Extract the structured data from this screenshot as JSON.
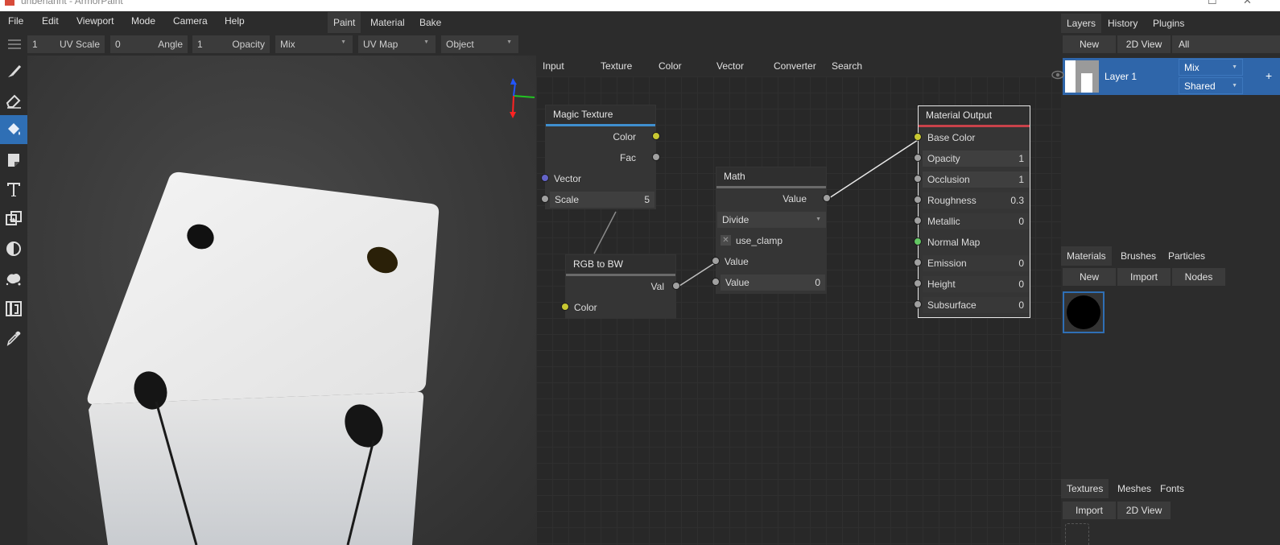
{
  "window": {
    "title": "unbehannt - ArmorPaint"
  },
  "menu": [
    "File",
    "Edit",
    "Viewport",
    "Mode",
    "Camera",
    "Help"
  ],
  "mode_tabs": [
    "Paint",
    "Material",
    "Bake"
  ],
  "toolbar": {
    "uv_scale": {
      "value": "1",
      "label": "UV Scale"
    },
    "angle": {
      "value": "0",
      "label": "Angle"
    },
    "opacity": {
      "value": "1",
      "label": "Opacity"
    },
    "blend": "Mix",
    "uv_map": "UV Map",
    "object": "Object"
  },
  "tools": [
    "brush-icon",
    "eraser-icon",
    "fill-icon",
    "decal-icon",
    "text-icon",
    "clone-icon",
    "blur-icon",
    "particle-icon",
    "bake-icon",
    "picker-icon"
  ],
  "node_categories": [
    "Input",
    "Texture",
    "Color",
    "Vector",
    "Converter",
    "Search"
  ],
  "nodes": {
    "magic_texture": {
      "title": "Magic Texture",
      "out_color": "Color",
      "out_fac": "Fac",
      "in_vector": "Vector",
      "scale_label": "Scale",
      "scale_value": "5"
    },
    "rgb_to_bw": {
      "title": "RGB to BW",
      "out_val": "Val",
      "in_color": "Color"
    },
    "math": {
      "title": "Math",
      "out_value": "Value",
      "operation": "Divide",
      "clamp_label": "use_clamp",
      "in_value1": "Value",
      "in_value2": "Value",
      "in_value2_num": "0"
    },
    "material_output": {
      "title": "Material Output",
      "base_color": "Base Color",
      "opacity": {
        "label": "Opacity",
        "value": "1"
      },
      "occlusion": {
        "label": "Occlusion",
        "value": "1"
      },
      "roughness": {
        "label": "Roughness",
        "value": "0.3"
      },
      "metallic": {
        "label": "Metallic",
        "value": "0"
      },
      "normal_map": "Normal Map",
      "emission": {
        "label": "Emission",
        "value": "0"
      },
      "height": {
        "label": "Height",
        "value": "0"
      },
      "subsurface": {
        "label": "Subsurface",
        "value": "0"
      }
    }
  },
  "right": {
    "tabs_top": [
      "Layers",
      "History",
      "Plugins"
    ],
    "layers_new": "New",
    "layers_2d": "2D View",
    "layers_filter": "All",
    "layer": {
      "name": "Layer 1",
      "blend": "Mix",
      "mode": "Shared"
    },
    "tabs_mid": [
      "Materials",
      "Brushes",
      "Particles"
    ],
    "mat_new": "New",
    "mat_import": "Import",
    "mat_nodes": "Nodes",
    "tabs_bottom": [
      "Textures",
      "Meshes",
      "Fonts"
    ],
    "tex_import": "Import",
    "tex_2d": "2D View"
  },
  "colors": {
    "accent": "#2f6fb5",
    "socket_color": "#c8c832",
    "socket_value": "#a0a0a0",
    "socket_vector": "#6363c7",
    "socket_shader": "#63c763"
  }
}
